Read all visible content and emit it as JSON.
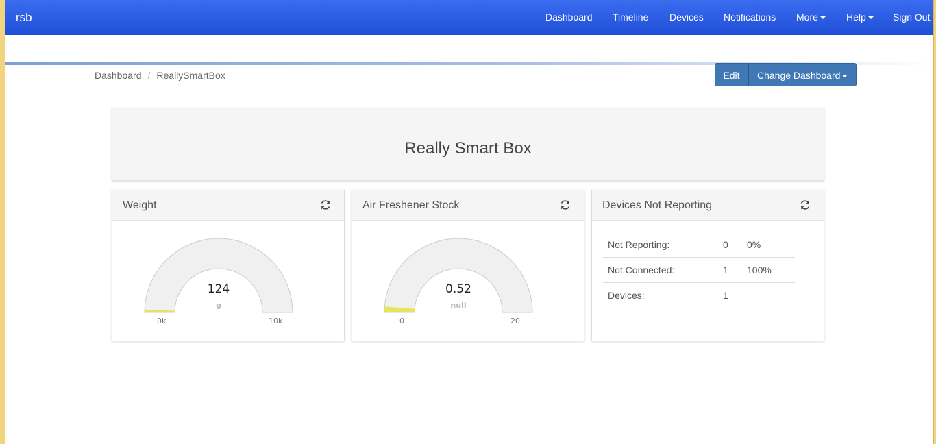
{
  "navbar": {
    "brand": "rsb",
    "items": [
      {
        "label": "Dashboard"
      },
      {
        "label": "Timeline"
      },
      {
        "label": "Devices"
      },
      {
        "label": "Notifications"
      },
      {
        "label": "More"
      },
      {
        "label": "Help"
      },
      {
        "label": "Sign Out"
      }
    ]
  },
  "breadcrumb": {
    "root": "Dashboard",
    "separator": "/",
    "current": "ReallySmartBox"
  },
  "toolbar": {
    "edit_label": "Edit",
    "change_dashboard_label": "Change Dashboard"
  },
  "dashboard": {
    "title": "Really Smart Box"
  },
  "widgets": {
    "weight": {
      "title": "Weight",
      "value": "124",
      "unit": "g",
      "min_label": "0k",
      "max_label": "10k",
      "fill_fraction": 0.0124
    },
    "air_freshener": {
      "title": "Air Freshener Stock",
      "value": "0.52",
      "unit": "null",
      "min_label": "0",
      "max_label": "20",
      "fill_fraction": 0.026
    },
    "devices_not_reporting": {
      "title": "Devices Not Reporting",
      "rows": [
        {
          "label": "Not Reporting:",
          "count": "0",
          "percent": "0%"
        },
        {
          "label": "Not Connected:",
          "count": "1",
          "percent": "100%"
        },
        {
          "label": "Devices:",
          "count": "1",
          "percent": ""
        }
      ]
    }
  },
  "colors": {
    "navbar_top": "#3a6cf0",
    "navbar_bottom": "#1f4fd6",
    "button": "#3f78b5",
    "gauge_fill": "#e6e45a",
    "gauge_track": "#f0f0f0"
  },
  "icons": {
    "widget_refresh": "refresh-icon",
    "dropdown": "caret-down-icon"
  }
}
